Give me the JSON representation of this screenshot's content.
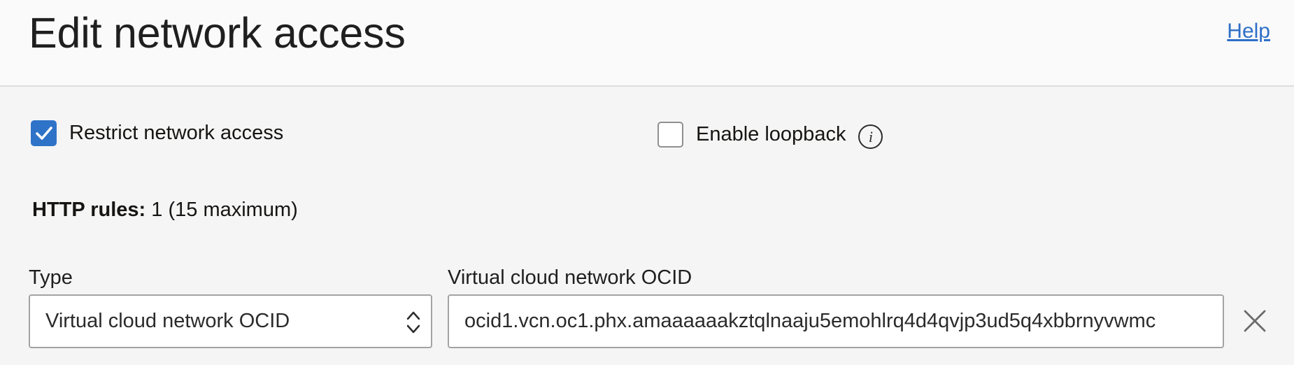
{
  "header": {
    "title": "Edit network access",
    "help_label": "Help"
  },
  "options": {
    "restrict": {
      "label": "Restrict network access",
      "checked": true
    },
    "loopback": {
      "label": "Enable loopback",
      "checked": false,
      "info_icon": "info-icon"
    }
  },
  "rules": {
    "label": "HTTP rules:",
    "count_text": "1 (15 maximum)"
  },
  "rule_row": {
    "type_label": "Type",
    "type_value": "Virtual cloud network OCID",
    "ocid_label": "Virtual cloud network OCID",
    "ocid_value": "ocid1.vcn.oc1.phx.amaaaaaakztqlnaaju5emohlrq4d4qvjp3ud5q4xbbrnyvwmc",
    "remove_icon": "close-icon"
  },
  "colors": {
    "accent": "#2f73c8",
    "link": "#2f6fc8",
    "background": "#f5f5f5"
  }
}
